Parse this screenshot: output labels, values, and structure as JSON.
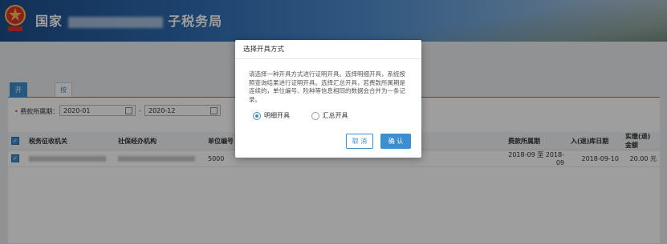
{
  "header": {
    "title_start": "国家",
    "title_end": "子税务局"
  },
  "tabs": [
    {
      "label": "开具证明"
    },
    {
      "label": "按缴费条件"
    }
  ],
  "filter": {
    "label": "费款所属期：",
    "date_from": "2020-01",
    "date_to": "2020-12",
    "separator": "-"
  },
  "table": {
    "columns": [
      "税务征收机关",
      "社保经办机构",
      "单位编号",
      "费款所属期",
      "入(退)库日期",
      "实缴(退)金额"
    ],
    "rows": [
      {
        "unit_no": "5000",
        "period": "2018-09 至 2018-09",
        "date": "2018-09-10",
        "amount": "20.00 元"
      }
    ]
  },
  "dialog": {
    "title": "选择开具方式",
    "message": "请选择一种开具方式进行证明开具。选择明细开具，系统按照查询结果进行证明开具。选择汇总开具，若费款所属期是连续的，单位编号、险种等信息相同的数据会合并为一条记录。",
    "option_detail": "明细开具",
    "option_summary": "汇总开具",
    "selected": "明细开具",
    "cancel_label": "取 消",
    "ok_label": "确 认"
  },
  "colors": {
    "accent": "#3c8ed1",
    "header": "#2f6fb3"
  }
}
